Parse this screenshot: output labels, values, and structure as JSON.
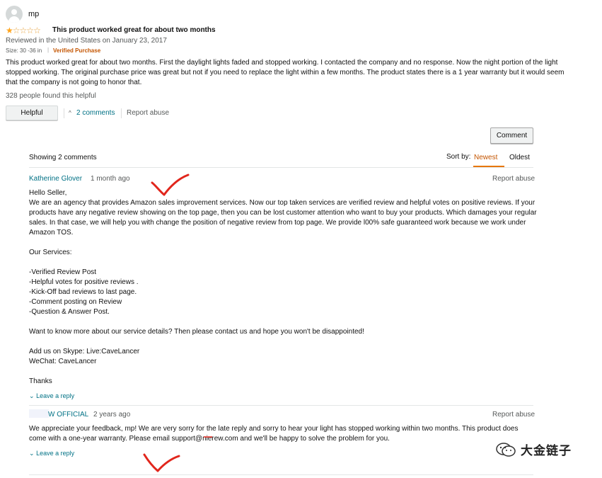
{
  "review": {
    "username": "mp",
    "rating": 1,
    "rating_max": 5,
    "title": "This product worked great for about two months",
    "meta": "Reviewed in the United States on January 23, 2017",
    "variant": "Size: 30 -36 in",
    "separator": "|",
    "verified": "Verified Purchase",
    "body": "This product worked great for about two months. First the daylight lights faded and stopped working. I contacted the company and no response. Now the night portion of the light stopped working. The original purchase price was great but not if you need to replace the light within a few months. The product states there is a 1 year warranty but it would seem that the company is not going to honor that.",
    "helpful_count": "328 people found this helpful",
    "helpful_label": "Helpful",
    "comments_link": "2 comments",
    "report_label": "Report abuse"
  },
  "comments_section": {
    "comment_button": "Comment",
    "showing": "Showing 2 comments",
    "sort_by": "Sort by:",
    "sort_newest": "Newest",
    "sort_oldest": "Oldest",
    "comments": [
      {
        "author": "Katherine Glover",
        "time": "1 month ago",
        "report": "Report abuse",
        "body": "Hello Seller,\nWe are an agency that provides Amazon sales improvement services. Now our top taken services are verified review and helpful votes on positive reviews. If your products have any negative review showing on the top page, then you can be lost customer attention who want to buy your products. Which damages your regular sales. In that case, we will help you with change the position of negative review from top page. We provide l00% safe guaranteed work because we work under Amazon TOS.\n\nOur Services:\n\n-Verified Review Post\n-Helpful votes for positive reviews .\n-Kick-Off bad reviews to last page.\n-Comment posting on Review\n-Question & Answer Post.\n\nWant to know more about our service details? Then please contact us and hope you won't be disappointed!\n\nAdd us on Skype: Live:CaveLancer\nWeChat: CaveLancer\n\nThanks",
        "reply": "Leave a reply"
      },
      {
        "author": "W OFFICIAL",
        "time": "2 years ago",
        "report": "Report abuse",
        "body": "We appreciate your feedback, mp! We are very sorry for the late reply and sorry to hear your light has stopped working within two months. This product does come with a one-year warranty. Please email support@nierew.com and we'll be happy to solve the problem for you.",
        "reply": "Leave a reply"
      }
    ]
  },
  "watermark": {
    "text": "大金链子"
  },
  "colors": {
    "link": "#007185",
    "accent": "#c45500",
    "star": "#ffa41c",
    "mark": "#e1261c"
  }
}
